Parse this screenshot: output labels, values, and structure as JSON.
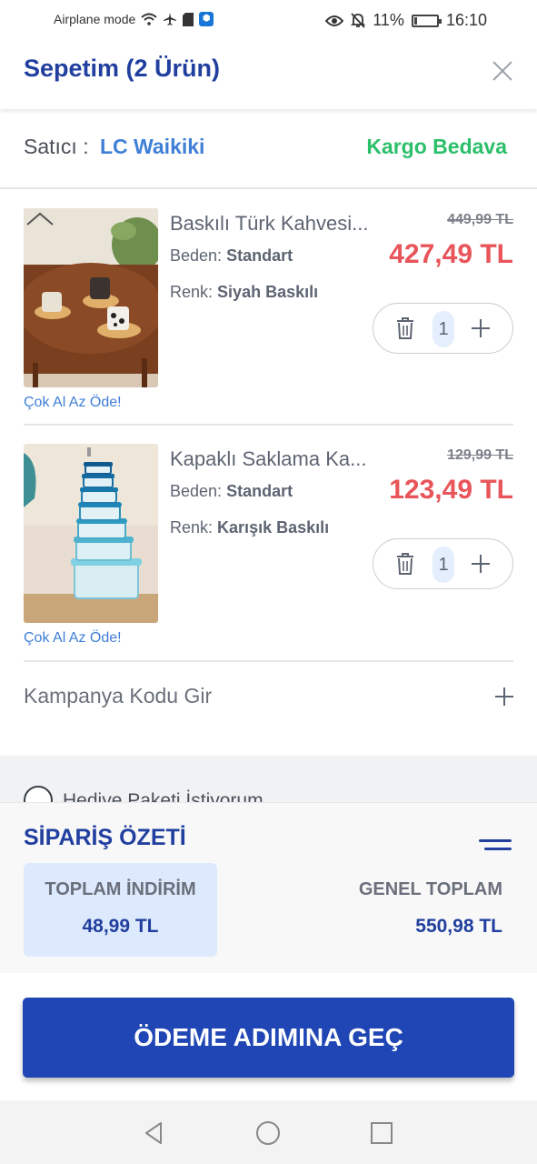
{
  "status_bar": {
    "left_text": "Airplane mode",
    "battery": "11%",
    "battery_level": 0.11,
    "time": "16:10"
  },
  "header": {
    "title": "Sepetim (2 Ürün)"
  },
  "seller": {
    "label": "Satıcı :",
    "name": "LC Waikiki",
    "shipping": "Kargo Bedava"
  },
  "products": [
    {
      "name": "Baskılı Türk Kahvesi...",
      "size_label": "Beden:",
      "size": "Standart",
      "color_label": "Renk:",
      "color": "Siyah Baskılı",
      "old_price": "449,99 TL",
      "price": "427,49 TL",
      "quantity": "1",
      "promo": "Çok Al Az Öde!"
    },
    {
      "name": "Kapaklı Saklama Ka...",
      "size_label": "Beden:",
      "size": "Standart",
      "color_label": "Renk:",
      "color": "Karışık Baskılı",
      "old_price": "129,99 TL",
      "price": "123,49 TL",
      "quantity": "1",
      "promo": "Çok Al Az Öde!"
    }
  ],
  "campaign": {
    "label": "Kampanya Kodu Gir"
  },
  "gift": {
    "label": "Hediye Paketi İstiyorum"
  },
  "summary": {
    "title": "SİPARİŞ ÖZETİ",
    "discount_label": "TOPLAM İNDİRİM",
    "discount_value": "48,99 TL",
    "total_label": "GENEL TOPLAM",
    "total_value": "550,98 TL"
  },
  "cta": {
    "label": "ÖDEME ADIMINA GEÇ"
  },
  "colors": {
    "brand_blue": "#213f9e",
    "cta_blue": "#1f46b4",
    "link_blue": "#3f7fd6",
    "price_red": "#e8555a",
    "shipping_green": "#2bbf6a"
  }
}
